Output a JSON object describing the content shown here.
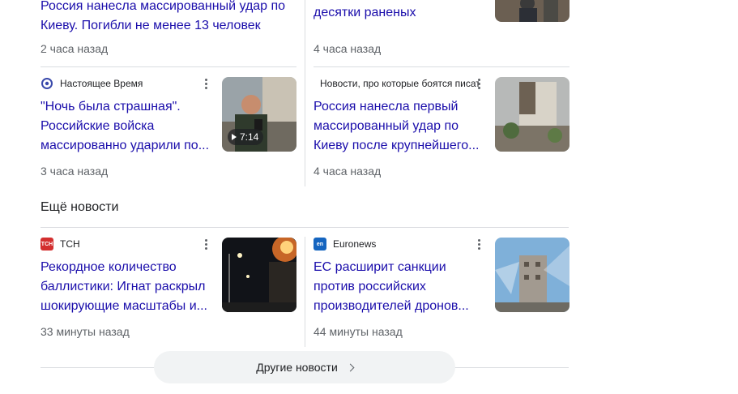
{
  "top_partial": {
    "left": {
      "title_line": "Россия нанесла массированный удар по Киеву. Погибли не менее 13 человек",
      "time": "2 часа назад"
    },
    "right": {
      "title_line": "десятки раненых",
      "time": "4 часа назад"
    }
  },
  "cards_row2": [
    {
      "source": "Настоящее Время",
      "title": "\"Ночь была страшная\". Российские войска массированно ударили по...",
      "time": "3 часа назад",
      "duration": "7:14"
    },
    {
      "source": "Новости, про которые боятся писать",
      "title": "Россия нанесла первый массированный удар по Киеву после крупнейшего...",
      "time": "4 часа назад"
    }
  ],
  "section": {
    "title": "Ещё новости"
  },
  "cards_row3": [
    {
      "source": "ТСН",
      "logo_text": "ТСН",
      "title": "Рекордное количество баллистики: Игнат раскрыл шокирующие масштабы и...",
      "time": "33 минуты назад"
    },
    {
      "source": "Euronews",
      "logo_text": "en",
      "title": "ЕС расширит санкции против российских производителей дронов...",
      "time": "44 минуты назад"
    }
  ],
  "more_button": {
    "label": "Другие новости"
  },
  "colors": {
    "link": "#1a0dab",
    "meta": "#5f6368",
    "divider": "#dadce0",
    "tsn": "#d32f2f",
    "euronews": "#1565c0"
  }
}
